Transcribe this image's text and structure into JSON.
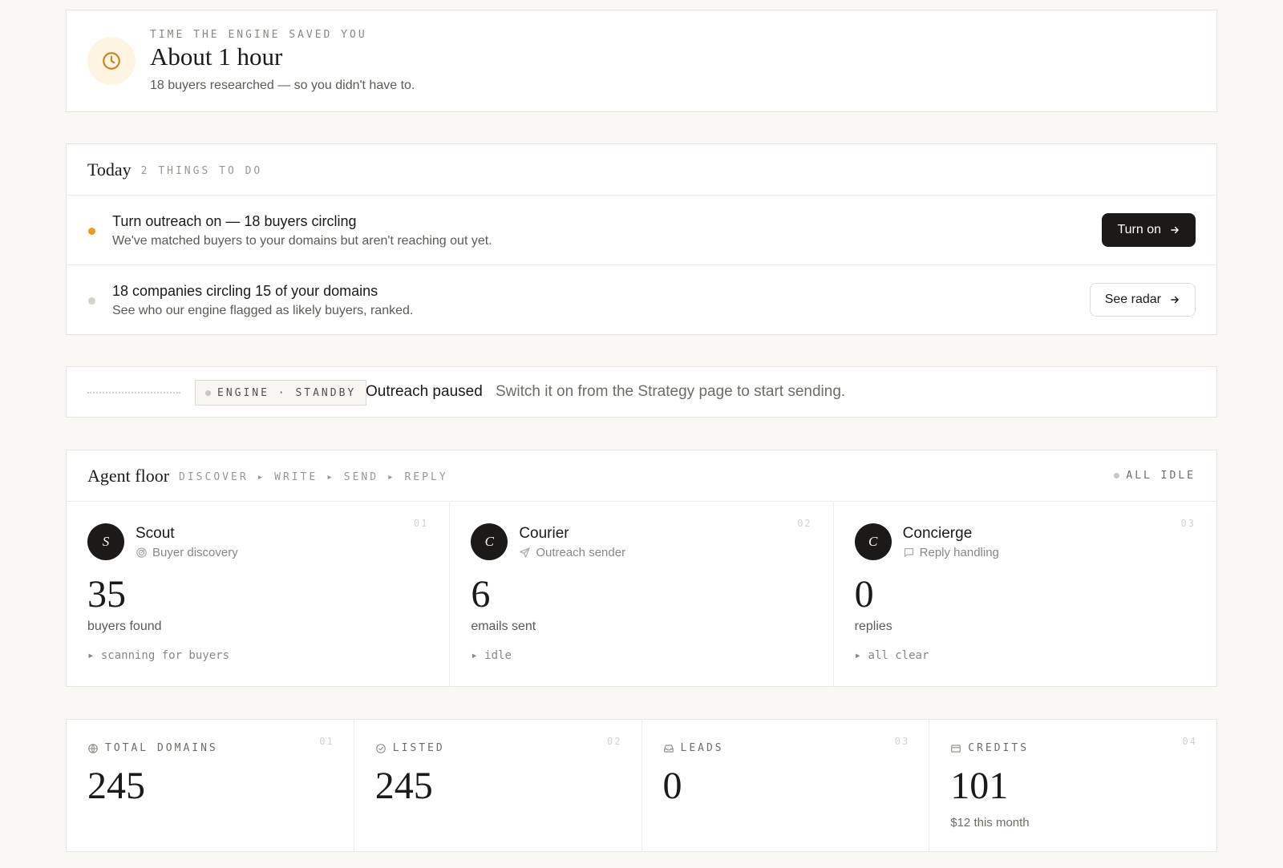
{
  "saved": {
    "eyebrow": "TIME THE ENGINE SAVED YOU",
    "title": "About 1 hour",
    "subtitle": "18 buyers researched — so you didn't have to.",
    "icon": "clock-icon",
    "accent": "#c9861a"
  },
  "today": {
    "title": "Today",
    "meta": "2 THINGS TO DO",
    "tasks": [
      {
        "title": "Turn outreach on — 18 buyers circling",
        "description": "We've matched buyers to your domains but aren't reaching out yet.",
        "button": "Turn on",
        "dot_color": "#f29a14"
      },
      {
        "title": "18 companies circling 15 of your domains",
        "description": "See who our engine flagged as likely buyers, ranked.",
        "button": "See radar",
        "dot_color": "#d4d1cb"
      }
    ]
  },
  "engine": {
    "chip_label": "ENGINE · STANDBY",
    "title": "Outreach paused",
    "description": "Switch it on from the Strategy page to start sending."
  },
  "agent_floor": {
    "title": "Agent floor",
    "pipeline": "DISCOVER ▸ WRITE ▸ SEND ▸ REPLY",
    "status": "ALL IDLE",
    "agents": [
      {
        "num": "01",
        "initial": "S",
        "name": "Scout",
        "role": "Buyer discovery",
        "role_icon": "radar-icon",
        "value": "35",
        "label": "buyers found",
        "state": "▸ scanning for buyers"
      },
      {
        "num": "02",
        "initial": "C",
        "name": "Courier",
        "role": "Outreach sender",
        "role_icon": "send-icon",
        "value": "6",
        "label": "emails sent",
        "state": "▸ idle"
      },
      {
        "num": "03",
        "initial": "C",
        "name": "Concierge",
        "role": "Reply handling",
        "role_icon": "chat-icon",
        "value": "0",
        "label": "replies",
        "state": "▸ all clear"
      }
    ]
  },
  "stats": [
    {
      "num": "01",
      "label": "TOTAL DOMAINS",
      "icon": "globe-icon",
      "value": "245",
      "sub": ""
    },
    {
      "num": "02",
      "label": "LISTED",
      "icon": "check-circle-icon",
      "value": "245",
      "sub": ""
    },
    {
      "num": "03",
      "label": "LEADS",
      "icon": "inbox-icon",
      "value": "0",
      "sub": ""
    },
    {
      "num": "04",
      "label": "CREDITS",
      "icon": "card-icon",
      "value": "101",
      "sub": "$12 this month"
    }
  ]
}
